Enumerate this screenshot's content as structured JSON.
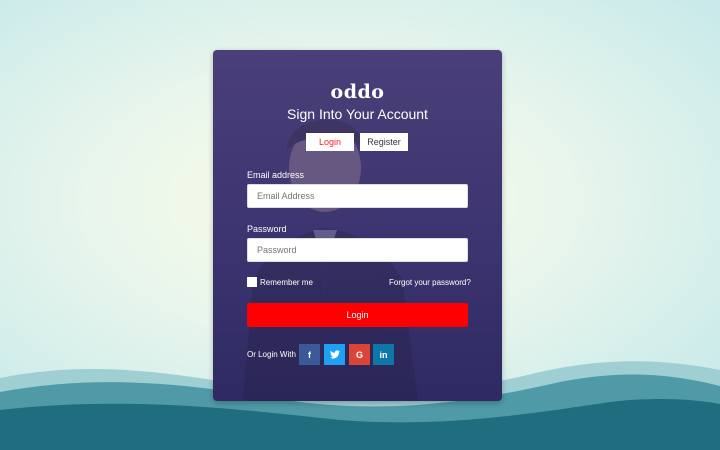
{
  "app": {
    "logo": "oddo",
    "heading": "Sign Into Your Account"
  },
  "tabs": [
    {
      "label": "Login",
      "active": true
    },
    {
      "label": "Register",
      "active": false
    }
  ],
  "form": {
    "email_label": "Email address",
    "email_placeholder": "Email Address",
    "email_value": "",
    "password_label": "Password",
    "password_placeholder": "Password",
    "password_value": "",
    "remember_label": "Remember me",
    "remember_checked": false,
    "forgot_link": "Forgot your password?",
    "submit_label": "Login"
  },
  "social": {
    "label": "Or Login With",
    "buttons": [
      {
        "name": "facebook",
        "glyph": "f",
        "color": "#3b5998"
      },
      {
        "name": "twitter",
        "glyph": "t",
        "color": "#1da1f2"
      },
      {
        "name": "google",
        "glyph": "G",
        "color": "#db4437"
      },
      {
        "name": "linkedin",
        "glyph": "in",
        "color": "#0e76a8"
      }
    ]
  },
  "colors": {
    "accent": "#ff0000",
    "card": "#3c3470",
    "active_tab_text": "#ff1a2e"
  }
}
